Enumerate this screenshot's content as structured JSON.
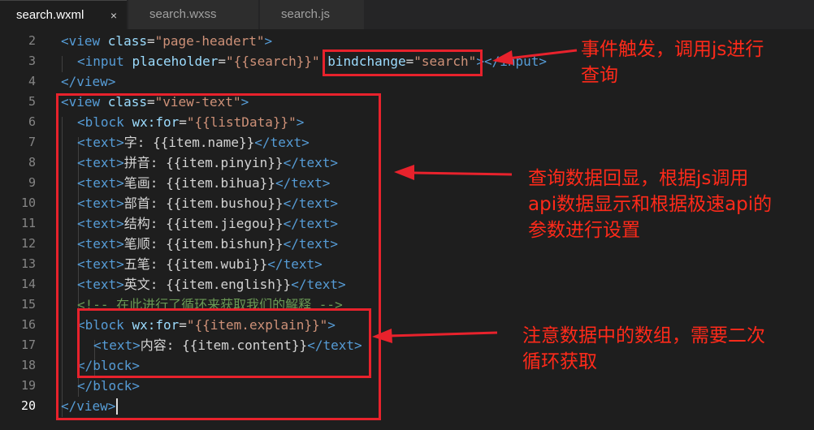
{
  "tabs": [
    {
      "label": "search.wxml",
      "active": true,
      "close": "×"
    },
    {
      "label": "search.wxss",
      "active": false
    },
    {
      "label": "search.js",
      "active": false
    }
  ],
  "line_numbers": [
    "2",
    "3",
    "4",
    "5",
    "6",
    "7",
    "8",
    "9",
    "10",
    "11",
    "12",
    "13",
    "14",
    "15",
    "16",
    "17",
    "18",
    "19",
    "20"
  ],
  "code": {
    "l2": {
      "open": "<view ",
      "attr": "class",
      "eq": "=",
      "val": "\"page-headert\"",
      "close": ">"
    },
    "l3": {
      "open": "<input ",
      "attr1": "placeholder",
      "eq1": "=",
      "val1": "\"{{search}}\"",
      "sp": " ",
      "attr2": "bindchange",
      "eq2": "=",
      "val2": "\"search\"",
      "close": "></input>"
    },
    "l4": {
      "tag": "</view>"
    },
    "l5": {
      "open": "<view ",
      "attr": "class",
      "eq": "=",
      "val": "\"view-text\"",
      "close": ">"
    },
    "l6": {
      "open": "<block ",
      "attr": "wx:for",
      "eq": "=",
      "val": "\"{{listData}}\"",
      "close": ">"
    },
    "l7": {
      "open": "<text>",
      "text": "字: {{item.name}}",
      "close": "</text>"
    },
    "l8": {
      "open": "<text>",
      "text": "拼音: {{item.pinyin}}",
      "close": "</text>"
    },
    "l9": {
      "open": "<text>",
      "text": "笔画: {{item.bihua}}",
      "close": "</text>"
    },
    "l10": {
      "open": "<text>",
      "text": "部首: {{item.bushou}}",
      "close": "</text>"
    },
    "l11": {
      "open": "<text>",
      "text": "结构: {{item.jiegou}}",
      "close": "</text>"
    },
    "l12": {
      "open": "<text>",
      "text": "笔顺: {{item.bishun}}",
      "close": "</text>"
    },
    "l13": {
      "open": "<text>",
      "text": "五笔: {{item.wubi}}",
      "close": "</text>"
    },
    "l14": {
      "open": "<text>",
      "text": "英文: {{item.english}}",
      "close": "</text>"
    },
    "l15": {
      "comment": "<!-- 在此进行了循环来获取我们的解释 -->"
    },
    "l16": {
      "open": "<block ",
      "attr": "wx:for",
      "eq": "=",
      "val": "\"{{item.explain}}\"",
      "close": ">"
    },
    "l17": {
      "open": "<text>",
      "text": "内容: {{item.content}}",
      "close": "</text>"
    },
    "l18": {
      "tag": "</block>"
    },
    "l19": {
      "tag": "</block>"
    },
    "l20": {
      "tag": "</view>"
    }
  },
  "annotations": {
    "a1": [
      "事件触发，调用js进行",
      "查询"
    ],
    "a2": [
      "查询数据回显，根据js调用",
      "api数据显示和根据极速api的",
      "参数进行设置"
    ],
    "a3": [
      "注意数据中的数组，需要二次",
      "循环获取"
    ]
  },
  "colors": {
    "annotation": "#e8222c",
    "background": "#1e1e1e"
  }
}
